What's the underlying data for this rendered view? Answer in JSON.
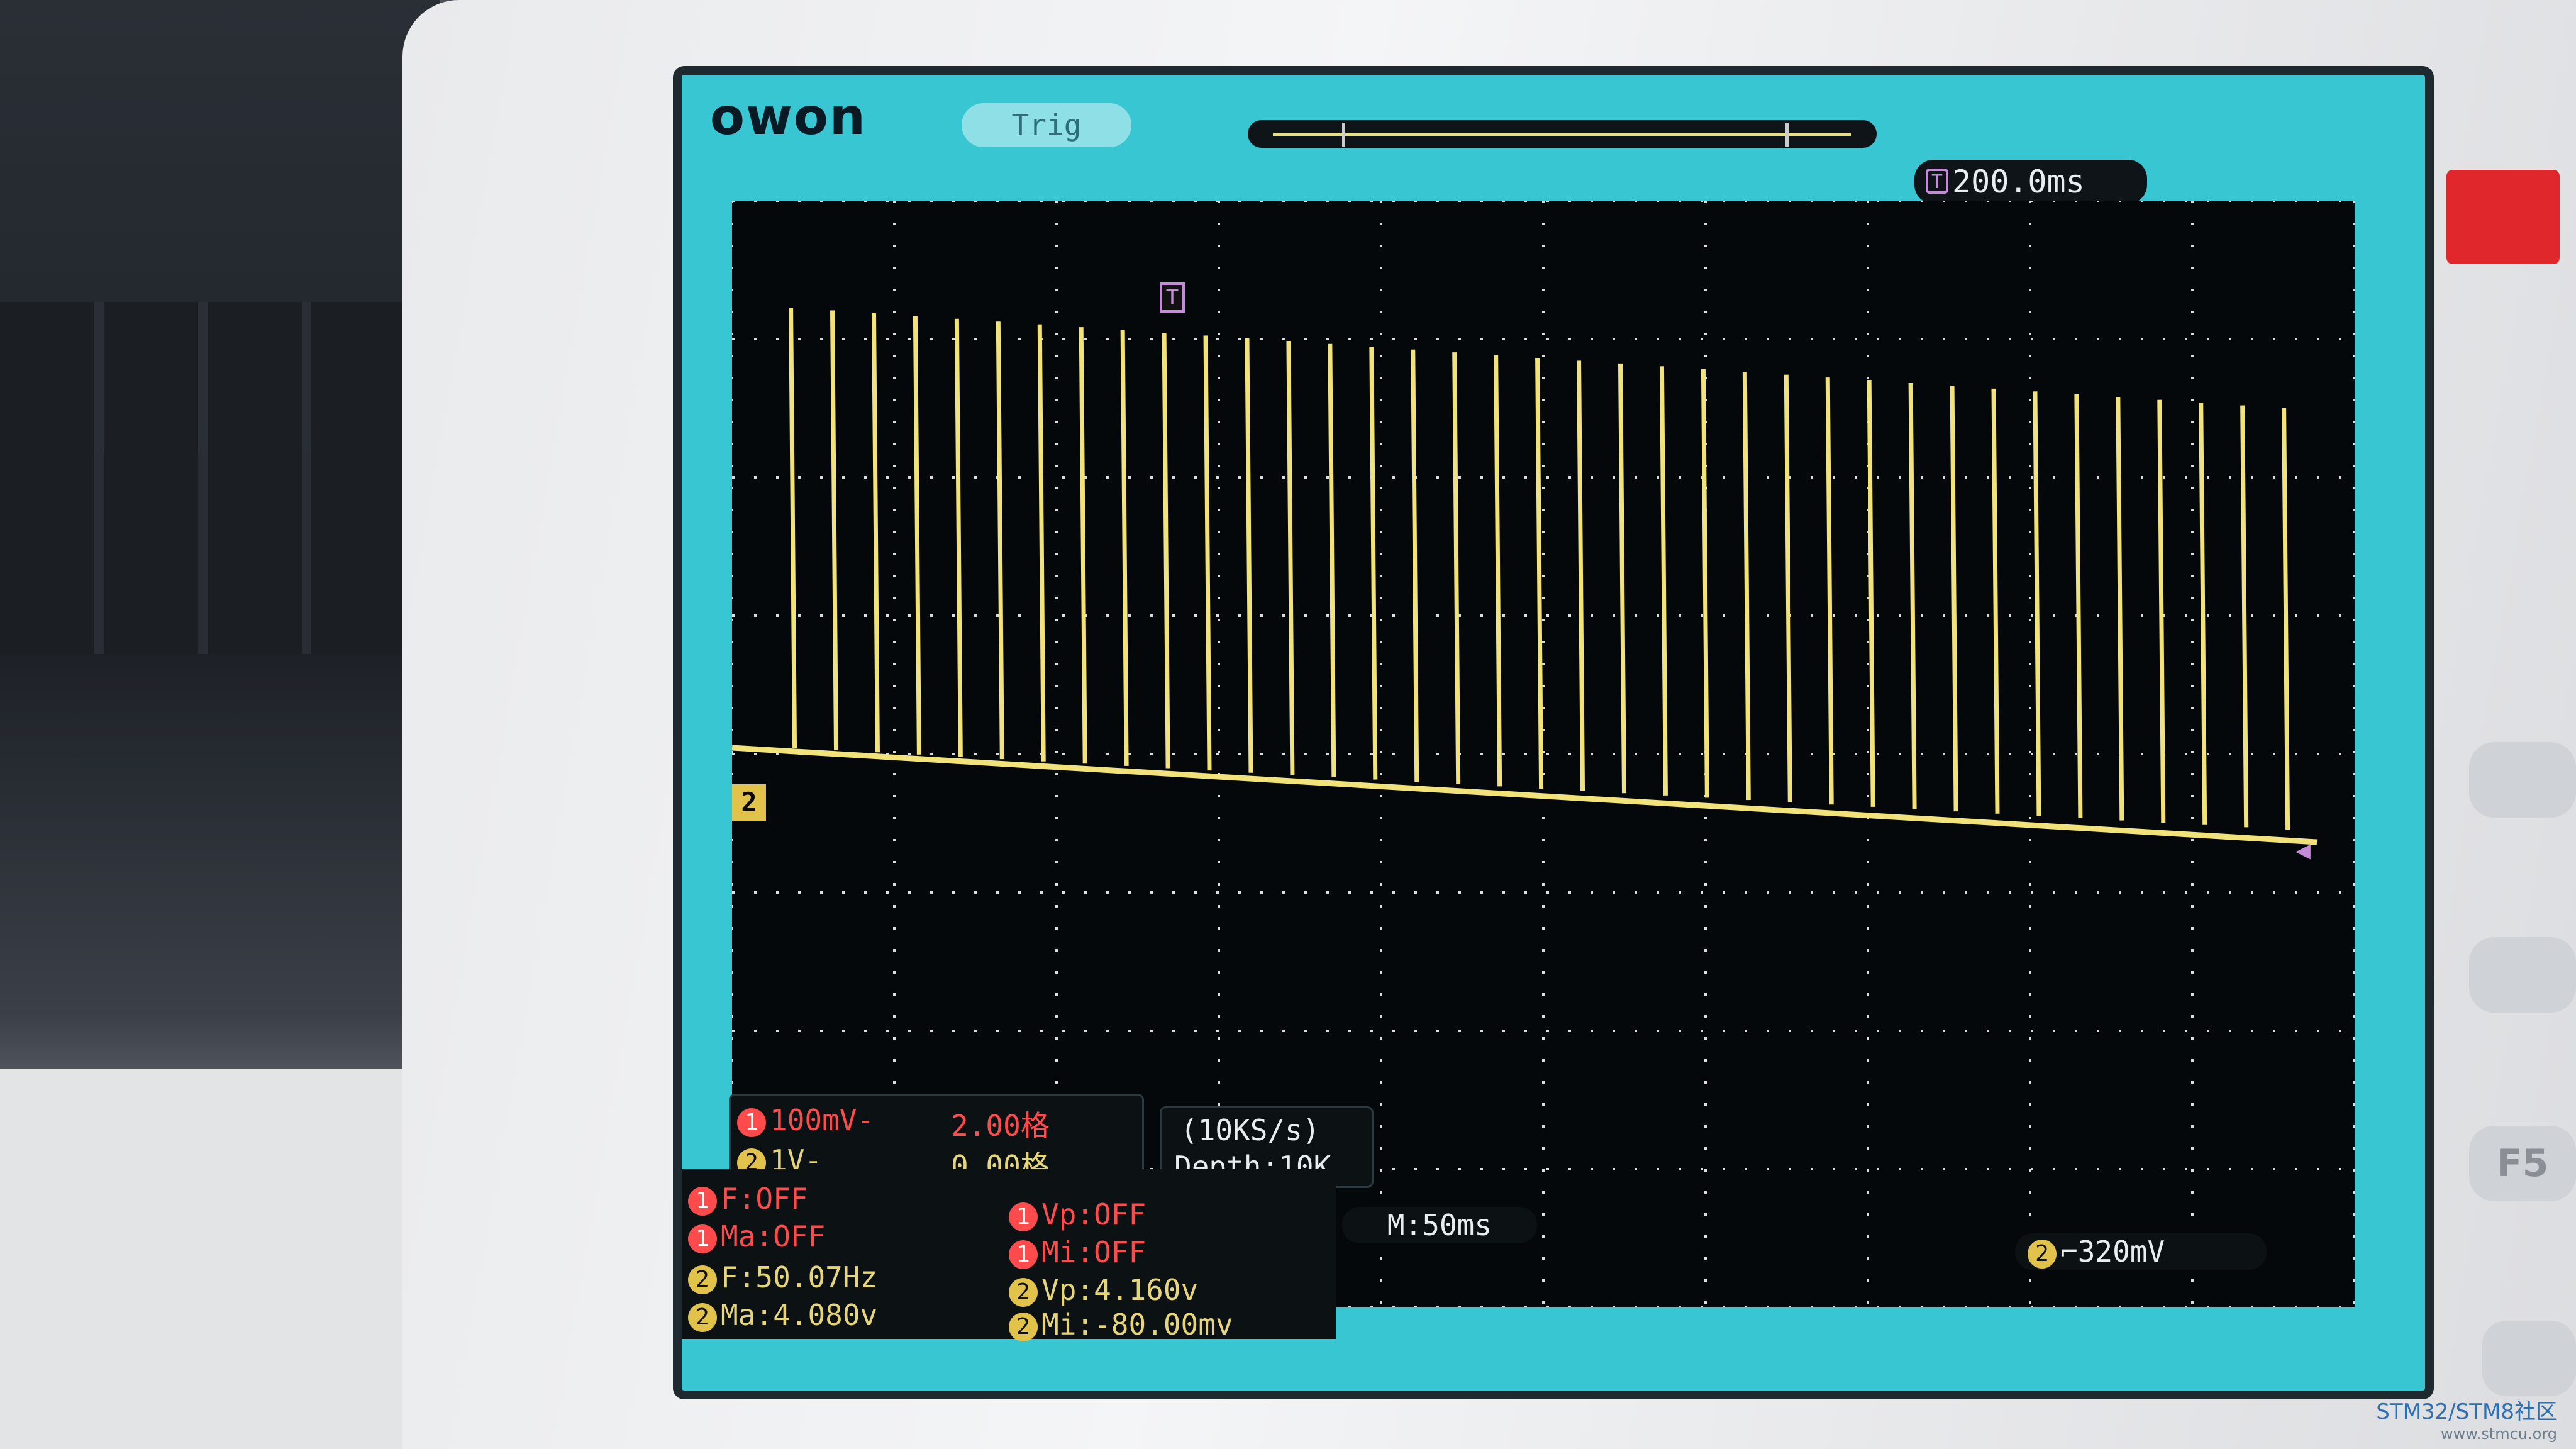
{
  "brand": "owon",
  "status": {
    "trig": "Trig"
  },
  "timebase": {
    "icon_label": "T",
    "value": "200.0ms"
  },
  "main_timebase": "M:50ms",
  "trigger_level": {
    "channel": "2",
    "value": "320mV"
  },
  "channel_marker": "2",
  "trigger_marker": "T",
  "channels": [
    {
      "num": "1",
      "scale": "100mV-",
      "offset": "2.00格"
    },
    {
      "num": "2",
      "scale": "1V-",
      "offset": "0.00格"
    }
  ],
  "acquisition": {
    "rate": "(10KS/s)",
    "depth": "Depth:10K"
  },
  "measurements": {
    "ch1_left": [
      {
        "num": "1",
        "text": "F:OFF"
      },
      {
        "num": "1",
        "text": "Ma:OFF"
      }
    ],
    "ch1_right": [
      {
        "num": "1",
        "text": "Vp:OFF"
      },
      {
        "num": "1",
        "text": "Mi:OFF"
      }
    ],
    "ch2_left": [
      {
        "num": "2",
        "text": "F:50.07Hz"
      },
      {
        "num": "2",
        "text": "Ma:4.080v"
      }
    ],
    "ch2_right": [
      {
        "num": "2",
        "text": "Vp:4.160v"
      },
      {
        "num": "2",
        "text": "Mi:-80.00mv"
      }
    ]
  },
  "side_keys": [
    "F5"
  ],
  "watermark": {
    "main": "STM32/STM8社区",
    "sub": "www.stmcu.org"
  },
  "colors": {
    "screen_bg": "#39c6d3",
    "grid_bg": "#05080a",
    "trace": "#f2e27a",
    "ch1": "#ff4b4b",
    "ch2": "#e1c24a",
    "trigger": "#c58ad8"
  },
  "waveform": {
    "type": "pulse-train",
    "pulse_count": 37,
    "frequency_hz": 50.07,
    "high_v": 4.08,
    "low_v": -0.08
  }
}
